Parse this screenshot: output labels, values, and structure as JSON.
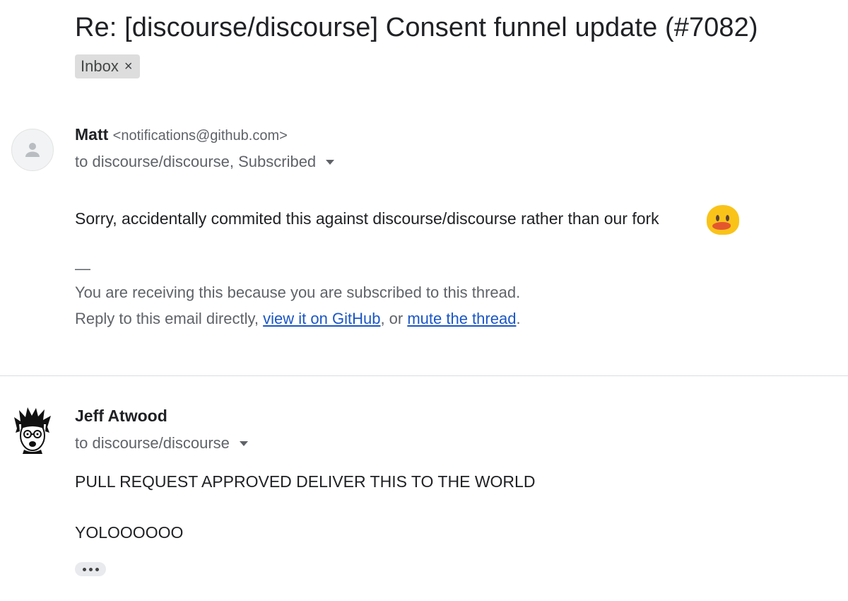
{
  "subject": "Re: [discourse/discourse] Consent funnel update (#7082)",
  "label": {
    "text": "Inbox",
    "remove_symbol": "×"
  },
  "messages": [
    {
      "sender_name": "Matt",
      "sender_email": "<notifications@github.com>",
      "recipients": "to discourse/discourse, Subscribed",
      "body": "Sorry, accidentally commited this against discourse/discourse rather than our fork",
      "emoji": "tongue-out-face-icon",
      "footer": {
        "separator": "—",
        "line1": "You are receiving this because you are subscribed to this thread.",
        "line2_prefix": "Reply to this email directly, ",
        "link1": "view it on GitHub",
        "line2_middle": ", or ",
        "link2": "mute the thread",
        "line2_suffix": "."
      }
    },
    {
      "sender_name": "Jeff Atwood",
      "recipients": "to discourse/discourse",
      "body_line1": "PULL REQUEST APPROVED DELIVER THIS TO THE WORLD",
      "body_line2": "YOLOOOOOO"
    }
  ],
  "colors": {
    "link": "#1a56c6",
    "label_bg": "#dddddd",
    "emoji": "#f9c31a"
  }
}
